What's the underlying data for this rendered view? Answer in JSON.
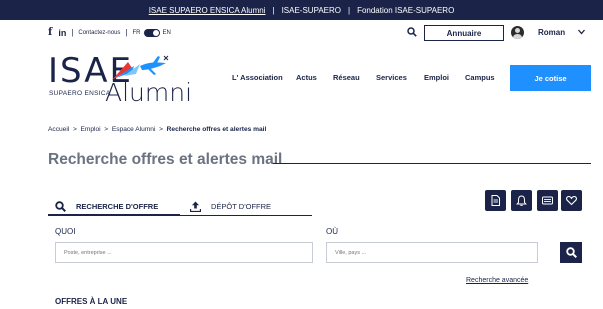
{
  "topbar": {
    "links": [
      "ISAE SUPAERO ENSICA Alumni",
      "ISAE-SUPAERO",
      "Fondation ISAE-SUPAERO"
    ],
    "separator": "|"
  },
  "subbar": {
    "facebook": "f",
    "linkedin": "in",
    "separator": "|",
    "contact": "Contactez-nous",
    "lang_fr": "FR",
    "lang_en": "EN",
    "annuaire": "Annuaire",
    "user_name": "Roman"
  },
  "logo": {
    "isae": "ISAE",
    "sub": "SUPAERO  ENSICA",
    "alumni": "Alumni"
  },
  "nav": {
    "items": [
      "L' Association",
      "Actus",
      "Réseau",
      "Services",
      "Emploi",
      "Campus"
    ],
    "cta": "Je cotise"
  },
  "breadcrumb": {
    "items": [
      "Accueil",
      "Emploi",
      "Espace Alumni",
      "Recherche offres et alertes mail"
    ],
    "separator": ">"
  },
  "page": {
    "title": "Recherche offres et alertes mail"
  },
  "tabs": {
    "search": "RECHERCHE D'OFFRE",
    "depot": "DÉPÔT D'OFFRE",
    "active": "search"
  },
  "actions": {
    "icons": [
      "document-icon",
      "bell-icon",
      "card-icon",
      "heart-icon"
    ]
  },
  "form": {
    "quoi_label": "QUOI",
    "quoi_placeholder": "Poste, entreprise ...",
    "ou_label": "OÙ",
    "ou_placeholder": "Ville, pays ...",
    "advanced": "Recherche avancée"
  },
  "featured": {
    "title": "OFFRES À LA UNE"
  },
  "colors": {
    "navy": "#1b2448",
    "accent_blue": "#1e90ff",
    "title_gray": "#6b7280"
  }
}
